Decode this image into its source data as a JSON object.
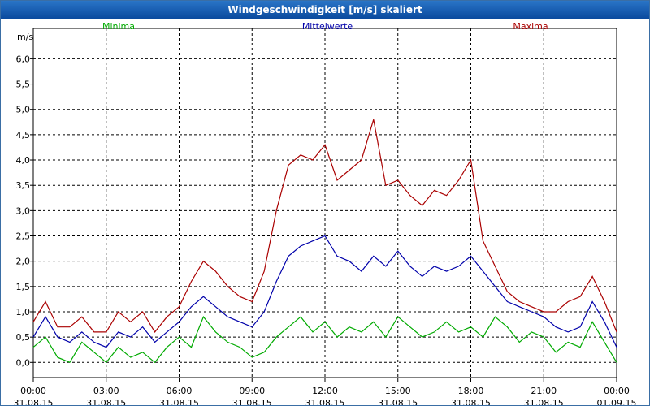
{
  "window": {
    "title": "Windgeschwindigkeit [m/s] skaliert"
  },
  "chart_data": {
    "type": "line",
    "title": "Windgeschwindigkeit [m/s] skaliert",
    "ylabel": "m/s",
    "ylim": [
      -0.3,
      6.6
    ],
    "yticks": [
      "0,0",
      "0,5",
      "1,0",
      "1,5",
      "2,0",
      "2,5",
      "3,0",
      "3,5",
      "4,0",
      "4,5",
      "5,0",
      "5,5",
      "6,0"
    ],
    "xlim": [
      "31.08.15 00:00",
      "01.09.15 00:00"
    ],
    "xticks": [
      {
        "time": "00:00",
        "date": "31.08.15"
      },
      {
        "time": "03:00",
        "date": "31.08.15"
      },
      {
        "time": "06:00",
        "date": "31.08.15"
      },
      {
        "time": "09:00",
        "date": "31.08.15"
      },
      {
        "time": "12:00",
        "date": "31.08.15"
      },
      {
        "time": "15:00",
        "date": "31.08.15"
      },
      {
        "time": "18:00",
        "date": "31.08.15"
      },
      {
        "time": "21:00",
        "date": "31.08.15"
      },
      {
        "time": "00:00",
        "date": "01.09.15"
      }
    ],
    "grid": true,
    "legend_placement": "top",
    "x_times": [
      "00:00",
      "00:30",
      "01:00",
      "01:30",
      "02:00",
      "02:30",
      "03:00",
      "03:30",
      "04:00",
      "04:30",
      "05:00",
      "05:30",
      "06:00",
      "06:30",
      "07:00",
      "07:30",
      "08:00",
      "08:30",
      "09:00",
      "09:30",
      "10:00",
      "10:30",
      "11:00",
      "11:30",
      "12:00",
      "12:30",
      "13:00",
      "13:30",
      "14:00",
      "14:30",
      "15:00",
      "15:30",
      "16:00",
      "16:30",
      "17:00",
      "17:30",
      "18:00",
      "18:30",
      "19:00",
      "19:30",
      "20:00",
      "20:30",
      "21:00",
      "21:30",
      "22:00",
      "22:30",
      "23:00",
      "23:30",
      "24:00"
    ],
    "series": [
      {
        "name": "Minima",
        "color": "#00aa00",
        "values": [
          0.3,
          0.5,
          0.1,
          0.0,
          0.4,
          0.2,
          0.0,
          0.3,
          0.1,
          0.2,
          0.0,
          0.3,
          0.5,
          0.3,
          0.9,
          0.6,
          0.4,
          0.3,
          0.1,
          0.2,
          0.5,
          0.7,
          0.9,
          0.6,
          0.8,
          0.5,
          0.7,
          0.6,
          0.8,
          0.5,
          0.9,
          0.7,
          0.5,
          0.6,
          0.8,
          0.6,
          0.7,
          0.5,
          0.9,
          0.7,
          0.4,
          0.6,
          0.5,
          0.2,
          0.4,
          0.3,
          0.8,
          0.4,
          0.0
        ]
      },
      {
        "name": "Mittelwerte",
        "color": "#0000aa",
        "values": [
          0.5,
          0.9,
          0.5,
          0.4,
          0.6,
          0.4,
          0.3,
          0.6,
          0.5,
          0.7,
          0.4,
          0.6,
          0.8,
          1.1,
          1.3,
          1.1,
          0.9,
          0.8,
          0.7,
          1.0,
          1.6,
          2.1,
          2.3,
          2.4,
          2.5,
          2.1,
          2.0,
          1.8,
          2.1,
          1.9,
          2.2,
          1.9,
          1.7,
          1.9,
          1.8,
          1.9,
          2.1,
          1.8,
          1.5,
          1.2,
          1.1,
          1.0,
          0.9,
          0.7,
          0.6,
          0.7,
          1.2,
          0.8,
          0.3
        ]
      },
      {
        "name": "Maxima",
        "color": "#aa0000",
        "values": [
          0.8,
          1.2,
          0.7,
          0.7,
          0.9,
          0.6,
          0.6,
          1.0,
          0.8,
          1.0,
          0.6,
          0.9,
          1.1,
          1.6,
          2.0,
          1.8,
          1.5,
          1.3,
          1.2,
          1.8,
          3.0,
          3.9,
          4.1,
          4.0,
          4.3,
          3.6,
          3.8,
          4.0,
          4.8,
          3.5,
          3.6,
          3.3,
          3.1,
          3.4,
          3.3,
          3.6,
          4.0,
          2.4,
          1.9,
          1.4,
          1.2,
          1.1,
          1.0,
          1.0,
          1.2,
          1.3,
          1.7,
          1.2,
          0.6
        ]
      }
    ]
  }
}
